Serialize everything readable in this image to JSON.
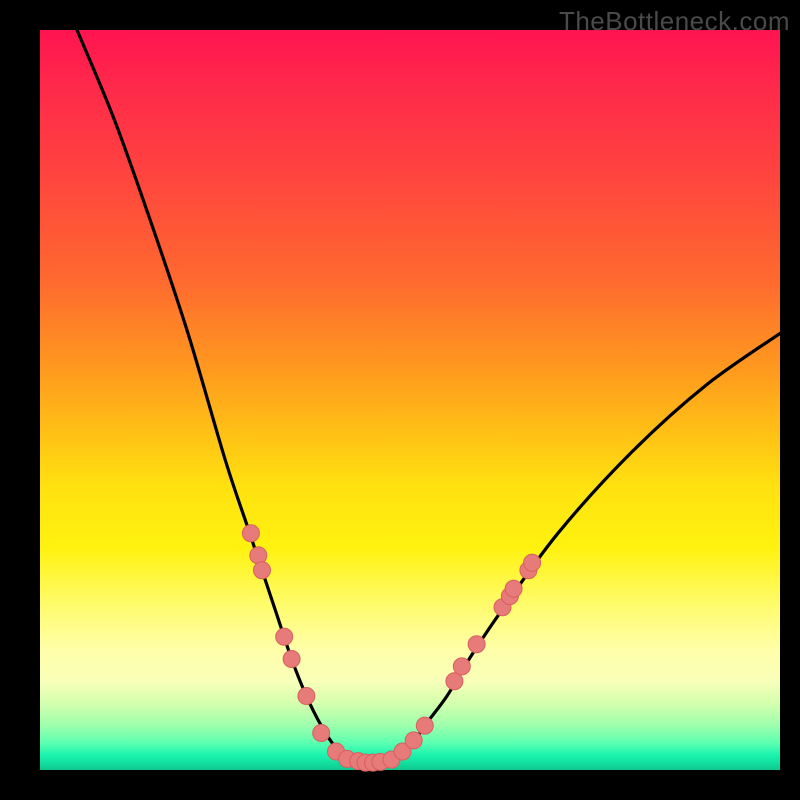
{
  "watermark": "TheBottleneck.com",
  "colors": {
    "background": "#000000",
    "curve": "#000000",
    "dot_fill": "#e77b7a",
    "dot_stroke": "#d85f5f",
    "gradient_top": "#ff1450",
    "gradient_bottom": "#0fc78f"
  },
  "chart_data": {
    "type": "line",
    "title": "",
    "xlabel": "",
    "ylabel": "",
    "xlim": [
      0,
      100
    ],
    "ylim": [
      0,
      100
    ],
    "grid": false,
    "legend_position": "none",
    "description": "V-shaped bottleneck curve; y is bottleneck percentage (high at extremes, ~0 at the sweet spot around x≈40–48). Background shades from red (high bottleneck) through yellow to green (low bottleneck).",
    "series": [
      {
        "name": "bottleneck-curve",
        "x": [
          5,
          10,
          15,
          20,
          25,
          28,
          30,
          32,
          34,
          36,
          38,
          40,
          42,
          44,
          46,
          48,
          50,
          52,
          55,
          58,
          62,
          70,
          80,
          90,
          100
        ],
        "y": [
          100,
          88,
          74,
          59,
          42,
          33,
          27,
          21,
          15,
          10,
          6,
          3,
          1.5,
          1,
          1,
          1.5,
          3,
          6,
          10,
          15,
          21,
          32,
          43,
          52,
          59
        ]
      }
    ],
    "highlight_points": {
      "name": "sample-dots",
      "points": [
        {
          "x": 28.5,
          "y": 32
        },
        {
          "x": 29.5,
          "y": 29
        },
        {
          "x": 30.0,
          "y": 27
        },
        {
          "x": 33.0,
          "y": 18
        },
        {
          "x": 34.0,
          "y": 15
        },
        {
          "x": 36.0,
          "y": 10
        },
        {
          "x": 38.0,
          "y": 5
        },
        {
          "x": 40.0,
          "y": 2.5
        },
        {
          "x": 41.5,
          "y": 1.5
        },
        {
          "x": 43.0,
          "y": 1.2
        },
        {
          "x": 44.0,
          "y": 1.0
        },
        {
          "x": 45.0,
          "y": 1.0
        },
        {
          "x": 46.0,
          "y": 1.1
        },
        {
          "x": 47.5,
          "y": 1.4
        },
        {
          "x": 49.0,
          "y": 2.5
        },
        {
          "x": 50.5,
          "y": 4
        },
        {
          "x": 52.0,
          "y": 6
        },
        {
          "x": 56.0,
          "y": 12
        },
        {
          "x": 57.0,
          "y": 14
        },
        {
          "x": 59.0,
          "y": 17
        },
        {
          "x": 62.5,
          "y": 22
        },
        {
          "x": 63.5,
          "y": 23.5
        },
        {
          "x": 64.0,
          "y": 24.5
        },
        {
          "x": 66.0,
          "y": 27
        },
        {
          "x": 66.5,
          "y": 28
        }
      ]
    }
  }
}
